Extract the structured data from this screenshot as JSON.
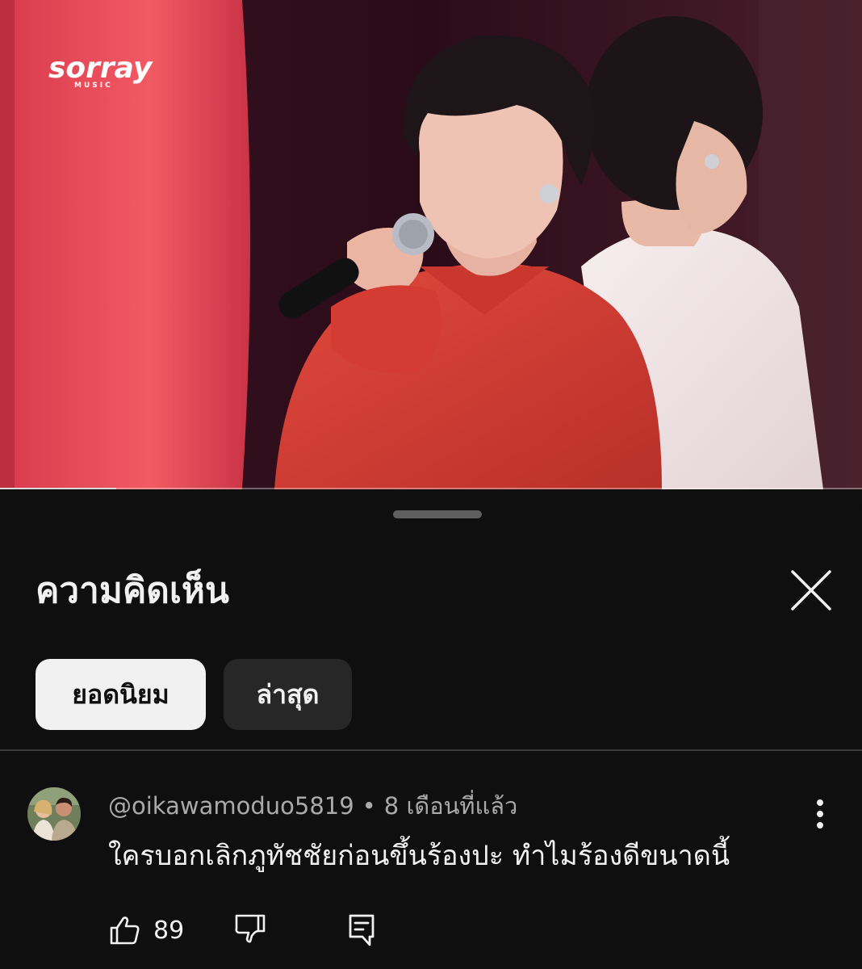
{
  "video": {
    "channel_logo_text": "sorray",
    "channel_logo_subtext": "MUSIC",
    "progress_fraction": 0.135
  },
  "comments_sheet": {
    "title": "ความคิดเห็น",
    "sort_chips": [
      {
        "label": "ยอดนิยม",
        "selected": true
      },
      {
        "label": "ล่าสุด",
        "selected": false
      }
    ]
  },
  "comment": {
    "author": "@oikawamoduo5819",
    "separator": "•",
    "time": "8 เดือนที่แล้ว",
    "text": "ใครบอกเลิกภูทัชชัยก่อนขึ้นร้องปะ ทำไมร้องดีขนาดนี้",
    "likes": "89"
  },
  "icons": {
    "close": "close-icon",
    "more": "more-vertical-icon",
    "like": "thumbs-up-icon",
    "dislike": "thumbs-down-icon",
    "reply": "reply-icon"
  },
  "colors": {
    "sheet_bg": "#0f0f0f",
    "text_primary": "#f1f1f1",
    "text_secondary": "#aaaaaa",
    "chip_selected_bg": "#f1f1f1",
    "chip_bg": "#272727"
  }
}
